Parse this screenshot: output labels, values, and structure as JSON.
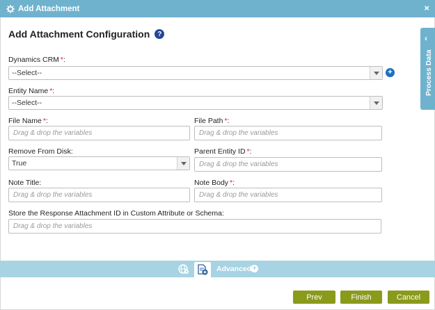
{
  "window": {
    "title": "Add Attachment",
    "close_glyph": "×"
  },
  "heading": {
    "text": "Add Attachment Configuration",
    "help_glyph": "?"
  },
  "fields": {
    "dynamics_crm": {
      "label": "Dynamics CRM",
      "required_mark": "*",
      "colon": ":",
      "value": "--Select--"
    },
    "entity_name": {
      "label": "Entity Name",
      "required_mark": "*",
      "colon": ":",
      "value": "--Select--"
    },
    "file_name": {
      "label": "File Name",
      "required_mark": "*",
      "colon": ":",
      "placeholder": "Drag & drop the variables"
    },
    "file_path": {
      "label": "File Path",
      "required_mark": "*",
      "colon": ":",
      "placeholder": "Drag & drop the variables"
    },
    "remove_from_disk": {
      "label": "Remove From Disk:",
      "value": "True"
    },
    "parent_entity_id": {
      "label": "Parent Entity ID",
      "required_mark": "*",
      "colon": ":",
      "placeholder": "Drag & drop the variables"
    },
    "note_title": {
      "label": "Note Title:",
      "placeholder": "Drag & drop the variables"
    },
    "note_body": {
      "label": "Note Body",
      "required_mark": "*",
      "colon": ":",
      "placeholder": "Drag & drop the variables"
    },
    "store_response": {
      "label": "Store the Response Attachment ID in Custom Attribute or Schema:",
      "placeholder": "Drag & drop the variables"
    }
  },
  "side_panel": {
    "label": "Process Data",
    "chevron": "‹"
  },
  "advanced": {
    "label": "Advanced",
    "plus_glyph": "+"
  },
  "buttons": {
    "prev": "Prev",
    "finish": "Finish",
    "cancel": "Cancel"
  },
  "colors": {
    "header": "#6fb2ce",
    "advanced_bar": "#a7d3e3",
    "button": "#8a9a1b",
    "required": "#d9231f",
    "help": "#24479a"
  }
}
